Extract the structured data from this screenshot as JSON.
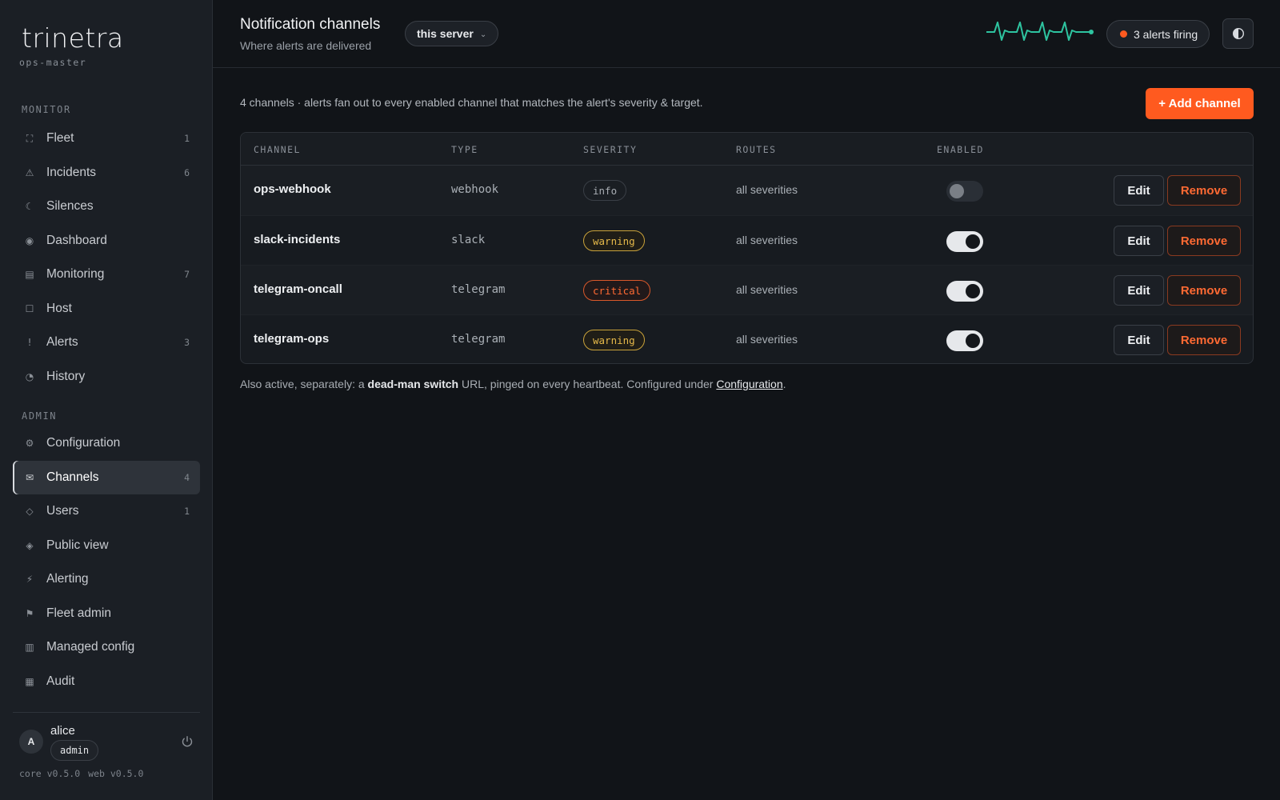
{
  "brand": {
    "logo": "trinetra",
    "subtitle": "ops-master"
  },
  "sidebar": {
    "monitor_label": "MONITOR",
    "admin_label": "ADMIN",
    "monitor_items": [
      {
        "label": "Fleet",
        "count": "1",
        "icon": "⛶"
      },
      {
        "label": "Incidents",
        "count": "6",
        "icon": "⚠"
      },
      {
        "label": "Silences",
        "count": "",
        "icon": "☾"
      },
      {
        "label": "Dashboard",
        "count": "",
        "icon": "◉"
      },
      {
        "label": "Monitoring",
        "count": "7",
        "icon": "▤"
      },
      {
        "label": "Host",
        "count": "",
        "icon": "☐"
      },
      {
        "label": "Alerts",
        "count": "3",
        "icon": "!"
      },
      {
        "label": "History",
        "count": "",
        "icon": "◔"
      }
    ],
    "admin_items": [
      {
        "label": "Configuration",
        "count": "",
        "icon": "⚙"
      },
      {
        "label": "Channels",
        "count": "4",
        "icon": "✉"
      },
      {
        "label": "Users",
        "count": "1",
        "icon": "◇"
      },
      {
        "label": "Public view",
        "count": "",
        "icon": "◈"
      },
      {
        "label": "Alerting",
        "count": "",
        "icon": "⚡"
      },
      {
        "label": "Fleet admin",
        "count": "",
        "icon": "⚑"
      },
      {
        "label": "Managed config",
        "count": "",
        "icon": "▥"
      },
      {
        "label": "Audit",
        "count": "",
        "icon": "▦"
      }
    ],
    "user": {
      "initial": "A",
      "name": "alice",
      "role": "admin"
    },
    "versions": {
      "core": "core v0.5.0",
      "web": "web v0.5.0"
    }
  },
  "header": {
    "title": "Notification channels",
    "subtitle": "Where alerts are delivered",
    "scope": "this server",
    "alerts_firing": "3 alerts firing"
  },
  "main": {
    "summary": "4 channels · alerts fan out to every enabled channel that matches the alert's severity & target.",
    "add_button": "+ Add channel",
    "columns": [
      "CHANNEL",
      "TYPE",
      "SEVERITY",
      "ROUTES",
      "ENABLED"
    ],
    "edit_label": "Edit",
    "remove_label": "Remove",
    "rows": [
      {
        "name": "ops-webhook",
        "type": "webhook",
        "severity": "info",
        "routes": "all severities",
        "enabled": false
      },
      {
        "name": "slack-incidents",
        "type": "slack",
        "severity": "warning",
        "routes": "all severities",
        "enabled": true
      },
      {
        "name": "telegram-oncall",
        "type": "telegram",
        "severity": "critical",
        "routes": "all severities",
        "enabled": true
      },
      {
        "name": "telegram-ops",
        "type": "telegram",
        "severity": "warning",
        "routes": "all severities",
        "enabled": true
      }
    ],
    "footnote": {
      "prefix": "Also active, separately: a ",
      "bold": "dead-man switch",
      "middle": " URL, pinged on every heartbeat. Configured under ",
      "link": "Configuration",
      "suffix": "."
    }
  },
  "colors": {
    "accent": "#ff5a1f",
    "background": "#111418",
    "sidebar": "#1b1f25",
    "pulse": "#2ec4a0",
    "warning": "#e6b94a",
    "critical": "#ff6a33"
  }
}
